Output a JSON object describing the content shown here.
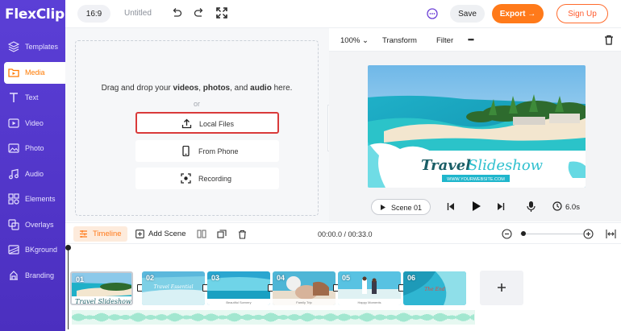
{
  "app": {
    "logo": "FlexClip"
  },
  "sidebar": {
    "items": [
      {
        "label": "Templates",
        "icon": "layers-icon"
      },
      {
        "label": "Media",
        "icon": "folder-icon",
        "active": true
      },
      {
        "label": "Text",
        "icon": "text-icon"
      },
      {
        "label": "Video",
        "icon": "video-icon"
      },
      {
        "label": "Photo",
        "icon": "photo-icon"
      },
      {
        "label": "Audio",
        "icon": "music-icon"
      },
      {
        "label": "Elements",
        "icon": "elements-icon"
      },
      {
        "label": "Overlays",
        "icon": "overlays-icon"
      },
      {
        "label": "BKground",
        "icon": "background-icon"
      },
      {
        "label": "Branding",
        "icon": "branding-icon"
      }
    ]
  },
  "topbar": {
    "ratio": "16:9",
    "title": "Untitled",
    "save": "Save",
    "export": "Export →",
    "signup": "Sign Up"
  },
  "media": {
    "drop_prefix": "Drag and drop your",
    "drop_videos": "videos",
    "drop_sep1": ",",
    "drop_photos": "photos",
    "drop_sep2": ", and",
    "drop_audio": "audio",
    "drop_suffix": "here.",
    "or": "or",
    "local_files": "Local Files",
    "from_phone": "From Phone",
    "recording": "Recording"
  },
  "preview": {
    "zoom": "100%",
    "transform": "Transform",
    "filter": "Filter",
    "more": "•••",
    "canvas_title_1": "Travel",
    "canvas_title_2": "Slideshow",
    "canvas_url": "WWW.YOURWEBSITE.COM",
    "scene": "Scene 01",
    "duration": "6.0s"
  },
  "timeline": {
    "tab": "Timeline",
    "add_scene": "Add Scene",
    "timecode": "00:00.0 / 00:33.0",
    "clips": [
      "01",
      "02",
      "03",
      "04",
      "05",
      "06"
    ],
    "clip_captions": [
      "Travel Slideshow",
      "Travel Essential",
      "Beautiful Scenery",
      "Family Trip",
      "Happy Moments",
      "The End"
    ],
    "zoom_level": 0.05
  },
  "colors": {
    "sidebar": "#5b3fd6",
    "accent": "#ff7a1a",
    "highlight": "#d93a3a",
    "waveform": "#5fd6b0"
  }
}
